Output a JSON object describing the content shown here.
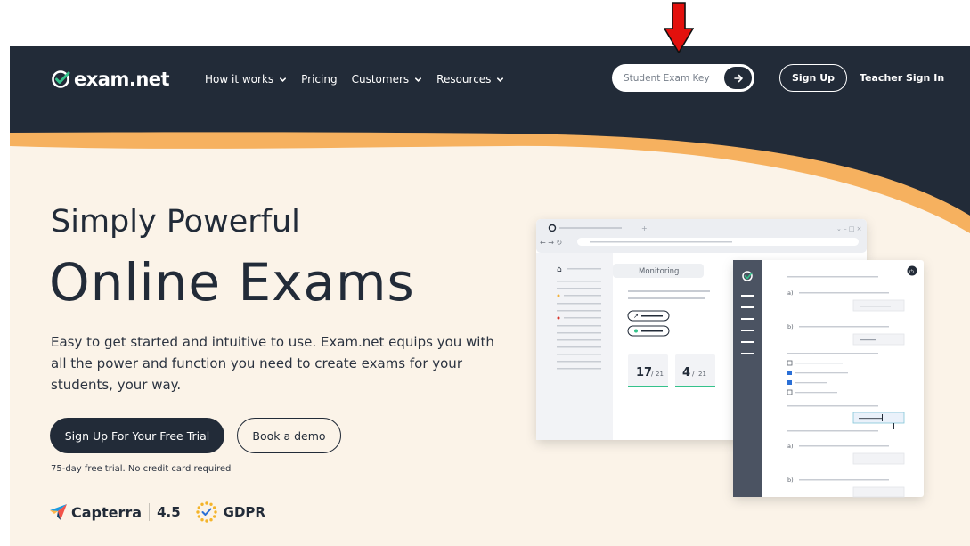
{
  "brand": {
    "name": "exam.net",
    "logo_icon": "checkmark-circle-icon"
  },
  "nav": {
    "items": [
      {
        "label": "How it works",
        "has_dropdown": true
      },
      {
        "label": "Pricing",
        "has_dropdown": false
      },
      {
        "label": "Customers",
        "has_dropdown": true
      },
      {
        "label": "Resources",
        "has_dropdown": true
      }
    ],
    "exam_key_placeholder": "Student Exam Key",
    "exam_key_submit_icon": "arrow-right-icon",
    "signup_label": "Sign Up",
    "teacher_signin_label": "Teacher Sign In"
  },
  "hero": {
    "subtitle": "Simply Powerful",
    "title": "Online Exams",
    "description": "Easy to get started and intuitive to use. Exam.net equips you with all the power and function you need to create exams for your students, your way.",
    "primary_cta": "Sign Up For Your Free Trial",
    "secondary_cta": "Book a demo",
    "trial_note": "75-day free trial. No credit card required"
  },
  "badges": {
    "capterra_label": "Capterra",
    "capterra_rating": "4.5",
    "gdpr_label": "GDPR"
  },
  "illustration": {
    "tab_label": "Monitoring",
    "stat_1_value": "17",
    "stat_1_total": "21",
    "stat_2_value": "4",
    "stat_2_total": "21",
    "answer_labels": [
      "a)",
      "b)",
      "a)",
      "b)"
    ]
  },
  "colors": {
    "navy": "#222b38",
    "cream": "#fbf3e8",
    "orange": "#f6b15f",
    "annotation_red": "#e3100d"
  },
  "annotation": {
    "icon": "red-down-arrow-icon"
  }
}
